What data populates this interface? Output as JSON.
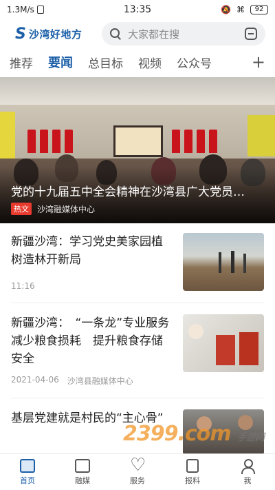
{
  "status_bar": {
    "speed": "1.3M/s",
    "time": "13:35",
    "battery": "92"
  },
  "header": {
    "logo_text": "沙湾好地方",
    "search_placeholder": "大家都在搜"
  },
  "tabs": [
    {
      "label": "推荐",
      "active": false
    },
    {
      "label": "要闻",
      "active": true
    },
    {
      "label": "总目标",
      "active": false
    },
    {
      "label": "视频",
      "active": false
    },
    {
      "label": "公众号",
      "active": false
    }
  ],
  "tab_plus": "+",
  "hero": {
    "title": "党的十九届五中全会精神在沙湾县广大党员…",
    "badge": "热文",
    "source": "沙湾融媒体中心"
  },
  "news": [
    {
      "title": "新疆沙湾：学习党史美家园植树造林开新局",
      "time": "11:16",
      "source": ""
    },
    {
      "title": "新疆沙湾：　“一条龙”专业服务　减少粮食损耗　提升粮食存储安全",
      "time": "2021-04-06",
      "source": "沙湾县融媒体中心"
    },
    {
      "title": "基层党建就是村民的“主心骨”",
      "time": "",
      "source": ""
    }
  ],
  "bottom_nav": [
    {
      "label": "首页",
      "icon": "home-icon",
      "active": true
    },
    {
      "label": "融媒",
      "icon": "media-icon",
      "active": false
    },
    {
      "label": "服务",
      "icon": "heart-icon",
      "active": false
    },
    {
      "label": "报料",
      "icon": "report-icon",
      "active": false
    },
    {
      "label": "我",
      "icon": "me-icon",
      "active": false
    }
  ],
  "watermark": "2399.com",
  "watermark_sub": "手游网",
  "colors": {
    "brand": "#1b5fa8",
    "hot_badge": "#e63b2e",
    "search_bg": "#f0f1f3"
  }
}
